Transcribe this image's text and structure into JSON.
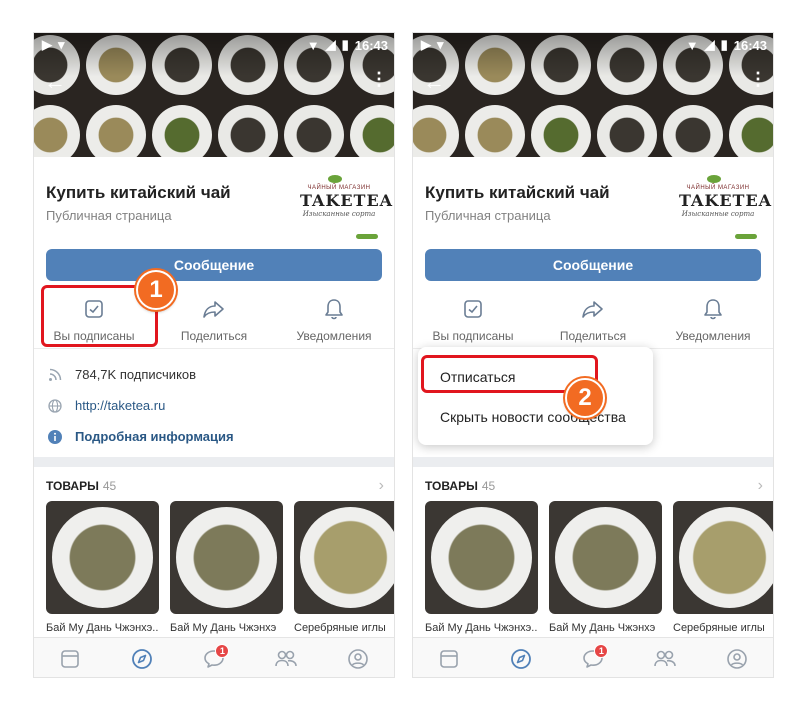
{
  "status_bar": {
    "time": "16:43"
  },
  "group": {
    "title": "Купить китайский чай",
    "subtitle": "Публичная страница",
    "logo": {
      "top": "ЧАЙНЫЙ МАГАЗИН",
      "main": "TAKETEA",
      "sub": "Изысканные сорта"
    }
  },
  "message_button": "Сообщение",
  "actions": [
    {
      "label": "Вы подписаны",
      "icon": "subscribed-check-icon"
    },
    {
      "label": "Поделиться",
      "icon": "share-arrow-icon"
    },
    {
      "label": "Уведомления",
      "icon": "bell-icon"
    }
  ],
  "info": {
    "subscribers": "784,7K подписчиков",
    "link": "http://taketea.ru",
    "details": "Подробная информация"
  },
  "goods": {
    "title": "ТОВАРЫ",
    "count": "45",
    "items": [
      "Бай Му Дань Чжэнхэ...",
      "Бай Му Дань Чжэнхэ",
      "Серебряные иглы"
    ]
  },
  "tabs": [
    {
      "icon": "news-icon"
    },
    {
      "icon": "explore-compass-icon"
    },
    {
      "icon": "messages-icon",
      "badge": "1"
    },
    {
      "icon": "friends-icon"
    },
    {
      "icon": "profile-icon"
    }
  ],
  "dropdown": [
    "Отписаться",
    "Скрыть новости сообщества"
  ],
  "steps": [
    "1",
    "2"
  ],
  "colors": {
    "accent": "#5181b8",
    "highlight": "#e1161e",
    "step": "#f26b22",
    "badge": "#e64646"
  }
}
